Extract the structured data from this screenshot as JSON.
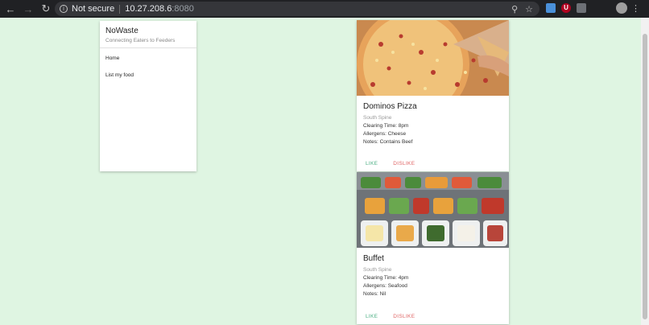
{
  "browser": {
    "security_label": "Not secure",
    "host": "10.27.208.6",
    "port": ":8080"
  },
  "app": {
    "title": "NoWaste",
    "subtitle": "Connecting Eaters to Feeders"
  },
  "sidebar": {
    "items": [
      {
        "label": "Home"
      },
      {
        "label": "List my food"
      }
    ]
  },
  "cards": [
    {
      "title": "Dominos Pizza",
      "location": "South Spine",
      "clearing_time": "Clearing Time: 8pm",
      "allergens": "Allergens: Cheese",
      "notes": "Notes: Contains Beef",
      "like": "LIKE",
      "dislike": "DISLIKE"
    },
    {
      "title": "Buffet",
      "location": "South Spine",
      "clearing_time": "Clearing Time: 4pm",
      "allergens": "Allergens: Seafood",
      "notes": "Notes: Nil",
      "like": "LIKE",
      "dislike": "DISLIKE"
    }
  ],
  "colors": {
    "page_bg": "#dff5e2",
    "like": "#4caf84",
    "dislike": "#e06666"
  }
}
